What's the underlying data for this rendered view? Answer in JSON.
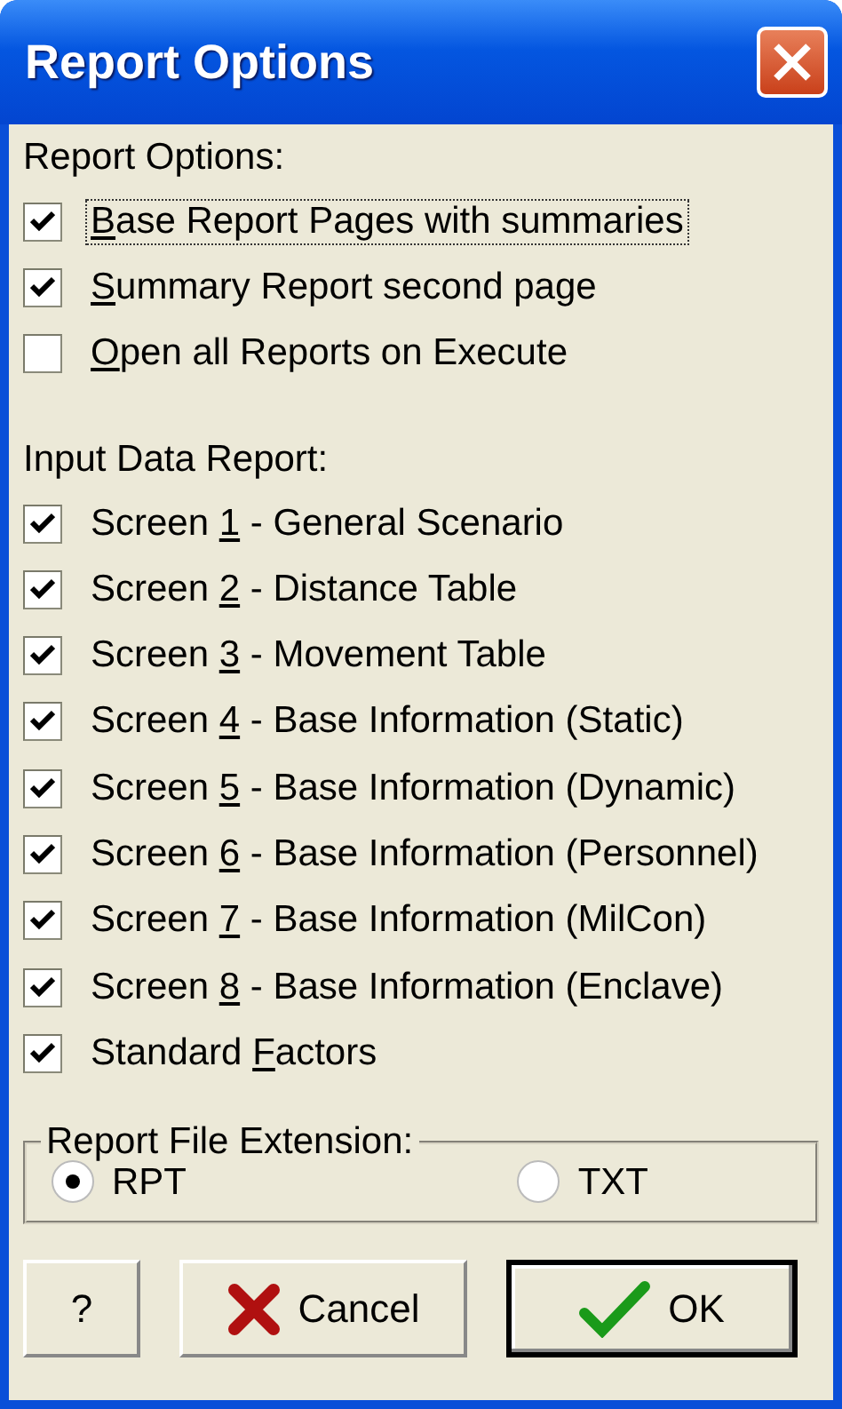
{
  "window": {
    "title": "Report Options"
  },
  "report_options": {
    "heading": "Report Options:",
    "items": [
      {
        "mnemonic": "B",
        "text_after": "ase Report Pages with summaries",
        "checked": true,
        "focused": true
      },
      {
        "mnemonic": "S",
        "text_after": "ummary Report second page",
        "checked": true,
        "focused": false
      },
      {
        "mnemonic": "O",
        "text_after": "pen all Reports on Execute",
        "checked": false,
        "focused": false
      }
    ]
  },
  "input_data_report": {
    "heading": "Input Data Report:",
    "items": [
      {
        "text_before": "Screen ",
        "mnemonic": "1",
        "text_after": " - General Scenario",
        "checked": true
      },
      {
        "text_before": "Screen ",
        "mnemonic": "2",
        "text_after": " - Distance Table",
        "checked": true
      },
      {
        "text_before": "Screen ",
        "mnemonic": "3",
        "text_after": " - Movement Table",
        "checked": true
      },
      {
        "text_before": "Screen ",
        "mnemonic": "4",
        "text_after": " - Base Information (Static)",
        "checked": true
      },
      {
        "text_before": "Screen ",
        "mnemonic": "5",
        "text_after": " - Base Information (Dynamic)",
        "checked": true
      },
      {
        "text_before": "Screen ",
        "mnemonic": "6",
        "text_after": " - Base Information (Personnel)",
        "checked": true
      },
      {
        "text_before": "Screen ",
        "mnemonic": "7",
        "text_after": " - Base Information (MilCon)",
        "checked": true
      },
      {
        "text_before": "Screen ",
        "mnemonic": "8",
        "text_after": " - Base Information (Enclave)",
        "checked": true
      },
      {
        "text_before": "Standard ",
        "mnemonic": "F",
        "text_after": "actors",
        "checked": true
      }
    ]
  },
  "file_extension": {
    "legend": "Report File Extension:",
    "options": [
      {
        "label": "RPT",
        "selected": true
      },
      {
        "label": "TXT",
        "selected": false
      }
    ]
  },
  "buttons": [
    {
      "kind": "help",
      "label": "?"
    },
    {
      "kind": "cancel",
      "label": "Cancel"
    },
    {
      "kind": "ok",
      "label": "OK",
      "default": true
    }
  ]
}
